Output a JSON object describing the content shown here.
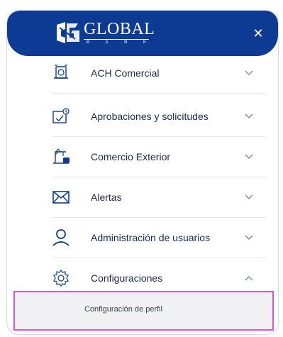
{
  "header": {
    "logo_word": "GLOBAL",
    "logo_sub": [
      "B",
      "A",
      "N",
      "K"
    ],
    "close_glyph": "✕",
    "bg_color": "#0d3b94"
  },
  "menu": {
    "items": [
      {
        "label": "ACH Comercial",
        "icon": "ach-transfer-icon",
        "state": "collapsed"
      },
      {
        "label": "Aprobaciones y solicitudes",
        "icon": "approval-document-icon",
        "state": "collapsed"
      },
      {
        "label": "Comercio Exterior",
        "icon": "trade-crane-icon",
        "state": "collapsed"
      },
      {
        "label": "Alertas",
        "icon": "envelope-icon",
        "state": "collapsed"
      },
      {
        "label": "Administración de usuarios",
        "icon": "user-icon",
        "state": "collapsed"
      },
      {
        "label": "Configuraciones",
        "icon": "gear-icon",
        "state": "expanded"
      }
    ],
    "submenu": {
      "label": "Configuración de perfil",
      "highlight_color": "#e44fd8"
    }
  },
  "colors": {
    "icon": "#0d3b94",
    "text": "#1d2b4a",
    "chevron": "#7c8aa8"
  }
}
